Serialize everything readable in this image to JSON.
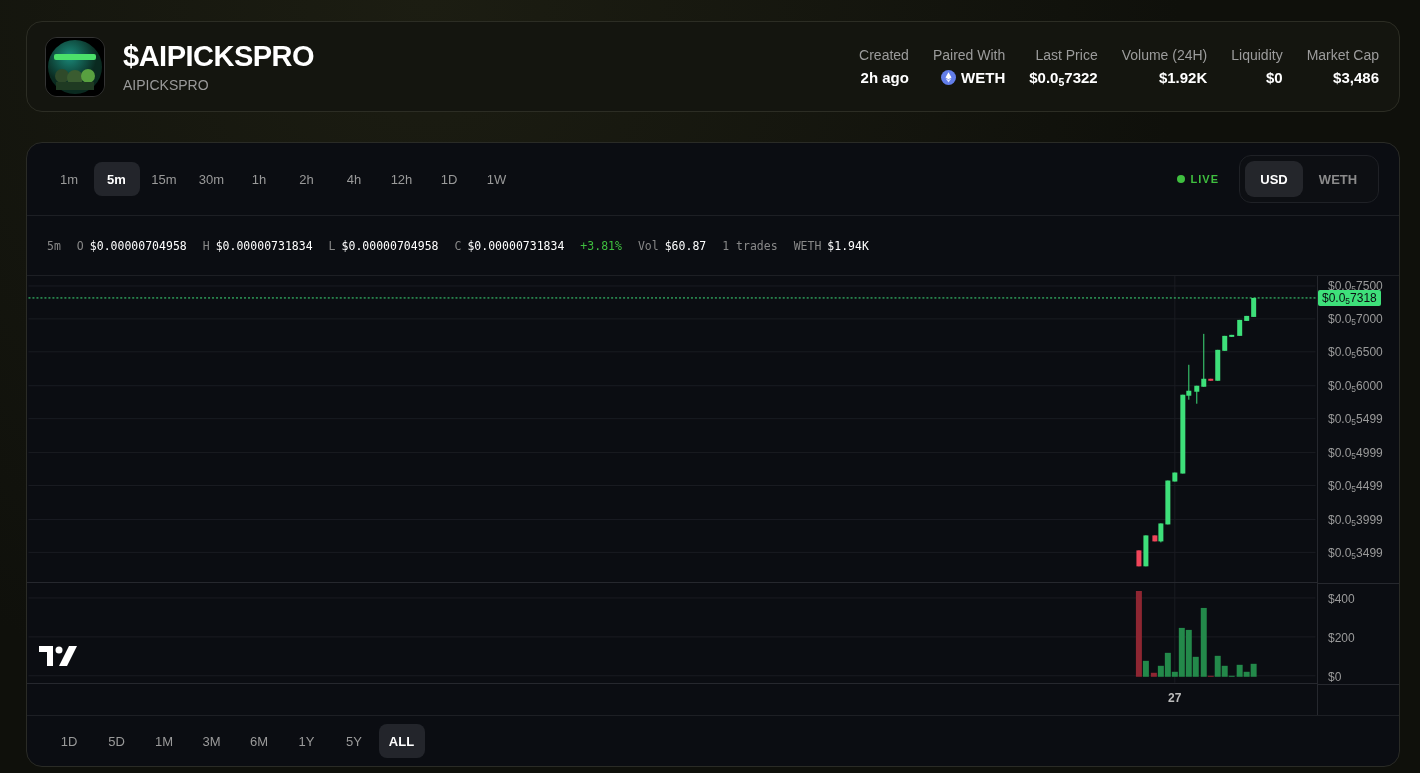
{
  "token": {
    "name": "$AIPICKSPRO",
    "symbol": "AIPICKSPRO"
  },
  "stats": [
    {
      "label": "Created",
      "value": "2h ago",
      "kind": "text"
    },
    {
      "label": "Paired With",
      "value": "WETH",
      "kind": "token"
    },
    {
      "label": "Last Price",
      "value": "$0.0$_{5}$7322",
      "kind": "text"
    },
    {
      "label": "Volume (24H)",
      "value": "$1.92K",
      "kind": "text"
    },
    {
      "label": "Liquidity",
      "value": "$0",
      "kind": "text"
    },
    {
      "label": "Market Cap",
      "value": "$3,486",
      "kind": "text"
    }
  ],
  "intervals": [
    {
      "label": "1m",
      "selected": false
    },
    {
      "label": "5m",
      "selected": true
    },
    {
      "label": "15m",
      "selected": false
    },
    {
      "label": "30m",
      "selected": false
    },
    {
      "label": "1h",
      "selected": false
    },
    {
      "label": "2h",
      "selected": false
    },
    {
      "label": "4h",
      "selected": false
    },
    {
      "label": "12h",
      "selected": false
    },
    {
      "label": "1D",
      "selected": false
    },
    {
      "label": "1W",
      "selected": false
    }
  ],
  "live": {
    "label": "LIVE",
    "on": true
  },
  "currencies": [
    {
      "label": "USD",
      "selected": true
    },
    {
      "label": "WETH",
      "selected": false
    }
  ],
  "ohlc": {
    "interval": "5m",
    "items": [
      {
        "label": "O",
        "value": "$0.00000704958",
        "kind": "plain"
      },
      {
        "label": "H",
        "value": "$0.00000731834",
        "kind": "plain"
      },
      {
        "label": "L",
        "value": "$0.00000704958",
        "kind": "plain"
      },
      {
        "label": "C",
        "value": "$0.00000731834",
        "kind": "plain"
      },
      {
        "value": "+3.81%",
        "kind": "change"
      },
      {
        "label": "Vol",
        "value": "$60.87",
        "kind": "plain"
      },
      {
        "value": "1 trades",
        "kind": "muted"
      },
      {
        "label": "WETH",
        "value": "$1.94K",
        "kind": "plain"
      }
    ]
  },
  "price_axis": [
    "$0.0$_{5}$7500",
    "$0.0$_{5}$7000",
    "$0.0$_{5}$6500",
    "$0.0$_{5}$6000",
    "$0.0$_{5}$5499",
    "$0.0$_{5}$4999",
    "$0.0$_{5}$4499",
    "$0.0$_{5}$3999",
    "$0.0$_{5}$3499"
  ],
  "current_price": "$0.0$_{5}$7318",
  "volume_axis": [
    "$400",
    "$200",
    "$0"
  ],
  "time_label": "27",
  "ranges": [
    {
      "label": "1D",
      "selected": false
    },
    {
      "label": "5D",
      "selected": false
    },
    {
      "label": "1M",
      "selected": false
    },
    {
      "label": "3M",
      "selected": false
    },
    {
      "label": "6M",
      "selected": false
    },
    {
      "label": "1Y",
      "selected": false
    },
    {
      "label": "5Y",
      "selected": false
    },
    {
      "label": "ALL",
      "selected": true
    }
  ]
}
